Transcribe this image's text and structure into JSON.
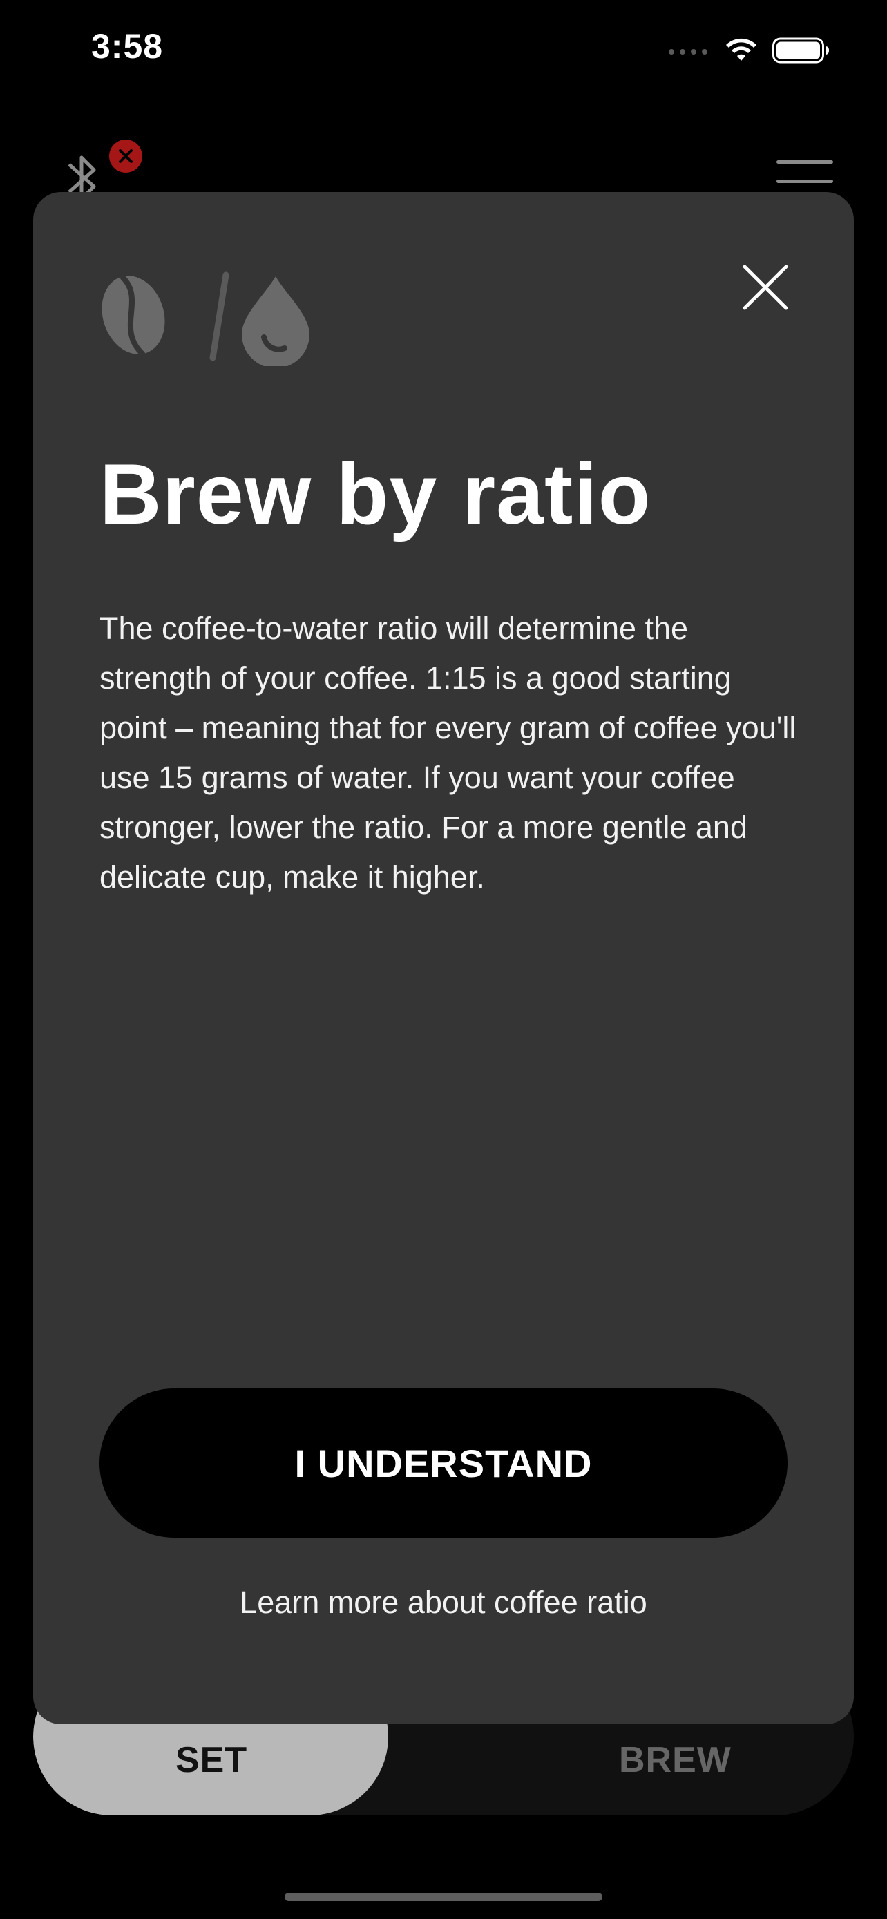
{
  "status_bar": {
    "time": "3:58",
    "icons": [
      "cellular-signal-icon",
      "wifi-icon",
      "battery-icon"
    ]
  },
  "app_bar": {
    "icons": [
      "bluetooth-icon",
      "disconnected-badge-icon",
      "menu-icon"
    ],
    "status_color": "#a51616"
  },
  "modal": {
    "icons": [
      "coffee-bean-icon",
      "water-drop-icon",
      "close-icon"
    ],
    "title": "Brew by ratio",
    "body": "The coffee-to-water ratio will determine the strength of your coffee. 1:15 is a good starting point – meaning that for every gram of coffee you'll use 15 grams of water. If you want your coffee stronger, lower the ratio. For a more gentle and delicate cup, make it higher.",
    "primary_button": "I UNDERSTAND",
    "secondary_link": "Learn more about coffee ratio"
  },
  "bottom_tabs": {
    "set_label": "SET",
    "brew_label": "BREW",
    "active": "SET"
  }
}
